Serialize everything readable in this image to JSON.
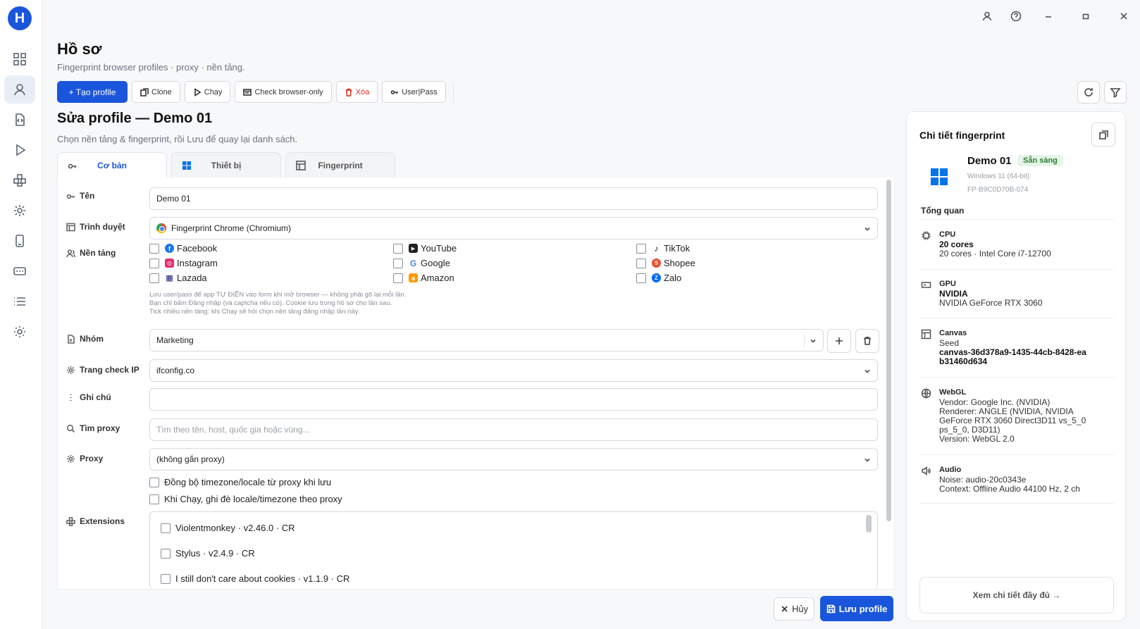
{
  "page": {
    "title": "Hồ sơ",
    "subtitle": "Fingerprint browser profiles · proxy · nền tảng."
  },
  "toolbar": {
    "create": "+ Tạo profile",
    "clone": "Clone",
    "run": "Chạy",
    "check": "Check browser-only",
    "delete": "Xóa",
    "userpass": "User|Pass"
  },
  "editor": {
    "title": "Sửa profile — Demo 01",
    "subtitle": "Chọn nền tảng & fingerprint, rồi Lưu để quay lại danh sách."
  },
  "tabs": [
    {
      "label": "Cơ bản",
      "icon": "link-icon"
    },
    {
      "label": "Thiết bị",
      "icon": "windows-icon"
    },
    {
      "label": "Fingerprint",
      "icon": "layout-icon"
    }
  ],
  "form": {
    "name_label": "Tên",
    "name_value": "Demo 01",
    "browser_label": "Trình duyệt",
    "browser_value": "Fingerprint Chrome (Chromium)",
    "platform_label": "Nền tảng",
    "platforms": [
      {
        "name": "Facebook",
        "color": "#1877f2",
        "glyph": "f"
      },
      {
        "name": "YouTube",
        "color": "#222222",
        "glyph": "▶"
      },
      {
        "name": "TikTok",
        "color": "#111111",
        "glyph": "♪"
      },
      {
        "name": "Instagram",
        "color": "#e1306c",
        "glyph": "◎"
      },
      {
        "name": "Google",
        "color": "#4285f4",
        "glyph": "G"
      },
      {
        "name": "Shopee",
        "color": "#ee4d2d",
        "glyph": "S"
      },
      {
        "name": "Lazada",
        "color": "#0f146d",
        "glyph": "▦"
      },
      {
        "name": "Amazon",
        "color": "#ff9900",
        "glyph": "a"
      },
      {
        "name": "Zalo",
        "color": "#0068ff",
        "glyph": "Z"
      }
    ],
    "hint_lines": [
      "Lưu user/pass để app TỰ ĐIỀN vào form khi mở browser — không phải gõ lại mỗi lần.",
      "Bạn chỉ bấm Đăng nhập (và captcha nếu có). Cookie lưu trong hồ sơ cho lần sau.",
      "Tick nhiều nền tảng: khi Chạy sẽ hỏi chọn nền tảng đăng nhập lần này."
    ],
    "group_label": "Nhóm",
    "group_value": "Marketing",
    "checkip_label": "Trang check IP",
    "checkip_value": "ifconfig.co",
    "note_label": "Ghi chú",
    "note_value": "",
    "findproxy_label": "Tìm proxy",
    "findproxy_placeholder": "Tìm theo tên, host, quốc gia hoặc vùng...",
    "proxy_label": "Proxy",
    "proxy_value": "(không gắn proxy)",
    "sync_tz": "Đồng bộ timezone/locale từ proxy khi lưu",
    "override_tz": "Khi Chạy, ghi đè locale/timezone theo proxy",
    "extensions_label": "Extensions",
    "extensions": [
      "Violentmonkey · v2.46.0 · CR",
      "Stylus · v2.4.9 · CR",
      "I still don't care about cookies · v1.1.9 · CR"
    ]
  },
  "actions": {
    "cancel": "Hủy",
    "save": "Lưu profile"
  },
  "fingerprint": {
    "title": "Chi tiết fingerprint",
    "name": "Demo 01",
    "status": "Sẵn sàng",
    "os": "Windows 11 (64-bit)",
    "id": "FP-B9C0D70B-074",
    "overview": "Tổng quan",
    "cpu": {
      "head": "CPU",
      "strong": "20 cores",
      "detail": "20 cores · Intel Core i7-12700"
    },
    "gpu": {
      "head": "GPU",
      "strong": "NVIDIA",
      "detail": "NVIDIA GeForce RTX 3060"
    },
    "canvas": {
      "head": "Canvas",
      "label": "Seed",
      "strong": "canvas-36d378a9-1435-44cb-8428-eab31460d634"
    },
    "webgl": {
      "head": "WebGL",
      "vendor": "Vendor: Google Inc. (NVIDIA)",
      "renderer": "Renderer: ANGLE (NVIDIA, NVIDIA GeForce RTX 3060 Direct3D11 vs_5_0 ps_5_0, D3D11)",
      "version": "Version: WebGL 2.0"
    },
    "audio": {
      "head": "Audio",
      "noise": "Noise: audio-20c0343e",
      "context": "Context: Offline Audio 44100 Hz, 2 ch"
    },
    "more": "Xem chi tiết đầy đủ →"
  }
}
